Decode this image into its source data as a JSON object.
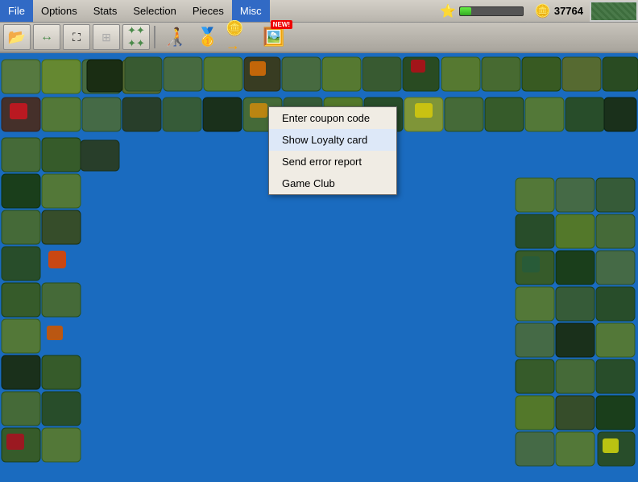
{
  "menubar": {
    "items": [
      "File",
      "Options",
      "Stats",
      "Selection",
      "Pieces",
      "Misc"
    ],
    "active": "Misc",
    "coins": "37764",
    "progress_percent": 18
  },
  "toolbar": {
    "buttons": [
      {
        "icon": "📂",
        "name": "open-folder-btn"
      },
      {
        "icon": "🔄",
        "name": "refresh-btn"
      },
      {
        "icon": "⛶",
        "name": "fit-btn"
      },
      {
        "icon": "⊞",
        "name": "grid-btn"
      },
      {
        "icon": "✦",
        "name": "star-btn"
      }
    ]
  },
  "misc_menu": {
    "items": [
      "Enter coupon code",
      "Show Loyalty card",
      "Send error report",
      "Game Club"
    ],
    "highlighted": "Show Loyalty card"
  },
  "game": {
    "background_color": "#1a6bbf"
  }
}
